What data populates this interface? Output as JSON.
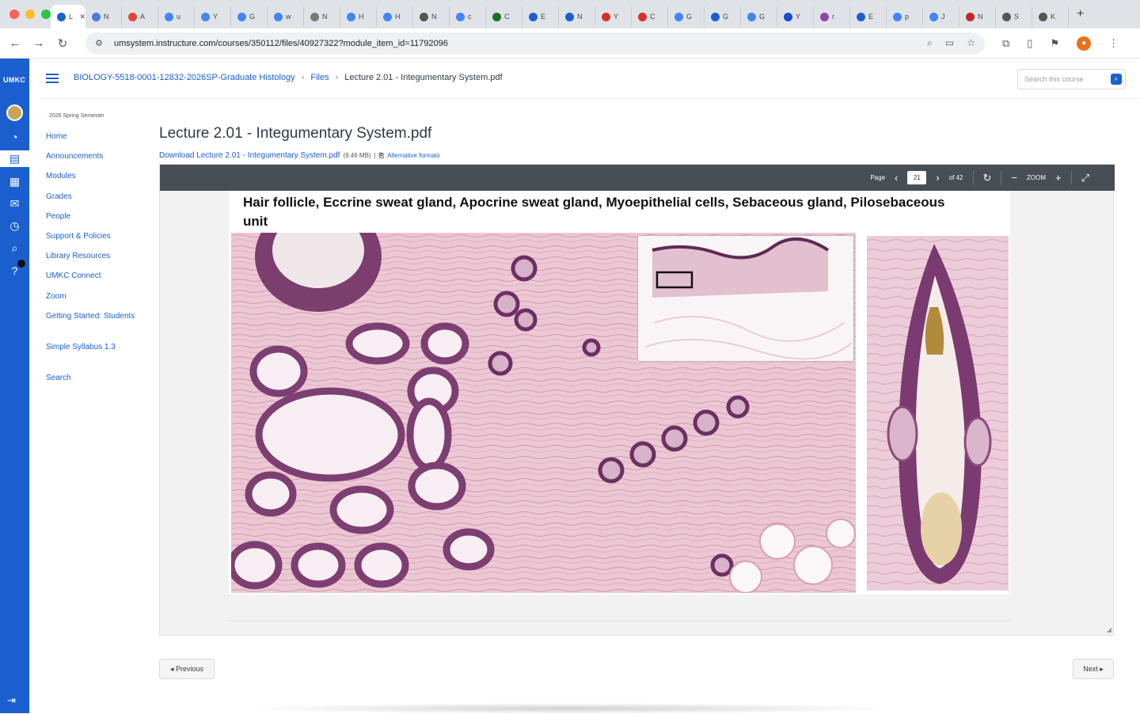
{
  "browser": {
    "traffic_colors": [
      "#ff5f57",
      "#febc2e",
      "#28c840"
    ],
    "active_tab_label": "L",
    "tabs": [
      {
        "label": "N",
        "color": "#4f7ad6"
      },
      {
        "label": "A",
        "color": "#e0463a"
      },
      {
        "label": "u",
        "color": "#4285f4"
      },
      {
        "label": "Y",
        "color": "#4285f4"
      },
      {
        "label": "G",
        "color": "#4285f4"
      },
      {
        "label": "w",
        "color": "#4285f4"
      },
      {
        "label": "N",
        "color": "#7a7a7a"
      },
      {
        "label": "H",
        "color": "#4285f4"
      },
      {
        "label": "H",
        "color": "#4285f4"
      },
      {
        "label": "N",
        "color": "#555555"
      },
      {
        "label": "c",
        "color": "#4285f4"
      },
      {
        "label": "C",
        "color": "#1f6e2a"
      },
      {
        "label": "E",
        "color": "#1b5fcf"
      },
      {
        "label": "N",
        "color": "#1b5fcf"
      },
      {
        "label": "Y",
        "color": "#d93025"
      },
      {
        "label": "C",
        "color": "#d93025"
      },
      {
        "label": "G",
        "color": "#4285f4"
      },
      {
        "label": "G",
        "color": "#1b5fcf"
      },
      {
        "label": "G",
        "color": "#4285f4"
      },
      {
        "label": "Y",
        "color": "#1a4bd6"
      },
      {
        "label": "r",
        "color": "#8e44ad"
      },
      {
        "label": "E",
        "color": "#1b5fcf"
      },
      {
        "label": "p",
        "color": "#4285f4"
      },
      {
        "label": "J",
        "color": "#4285f4"
      },
      {
        "label": "N",
        "color": "#c62828"
      },
      {
        "label": "S",
        "color": "#555555"
      },
      {
        "label": "K",
        "color": "#555555"
      }
    ],
    "new_tab": "+",
    "url": "umsystem.instructure.com/courses/350112/files/40927322?module_item_id=11792096"
  },
  "canvas": {
    "brand_color": "#1b5fcf",
    "logo": "UMKC",
    "breadcrumb": {
      "course": "BIOLOGY-5518-0001-12832-2026SP-Graduate Histology",
      "files": "Files",
      "current": "Lecture 2.01 - Integumentary System.pdf"
    },
    "search_placeholder": "Search this course",
    "term": "2026 Spring Semester",
    "course_nav": [
      "Home",
      "Announcements",
      "Modules",
      "Grades",
      "People",
      "Support & Policies",
      "Library Resources",
      "UMKC Connect",
      "Zoom",
      "Getting Started: Students",
      "Simple Syllabus 1.3",
      "Search"
    ]
  },
  "content": {
    "title": "Lecture 2.01 - Integumentary System.pdf",
    "download_link": "Download Lecture 2.01 - Integumentary System.pdf",
    "file_size": "(9.46 MB)",
    "alt_formats": "Alternative formats",
    "viewer": {
      "page_label": "Page",
      "page_number": "21",
      "page_total": "of 42",
      "zoom": "ZOOM"
    },
    "slide_title": "Hair follicle, Eccrine sweat gland, Apocrine sweat gland, Myoepithelial cells, Sebaceous gland, Pilosebaceous unit",
    "prev_label": "◂ Previous",
    "next_label": "Next ▸"
  }
}
